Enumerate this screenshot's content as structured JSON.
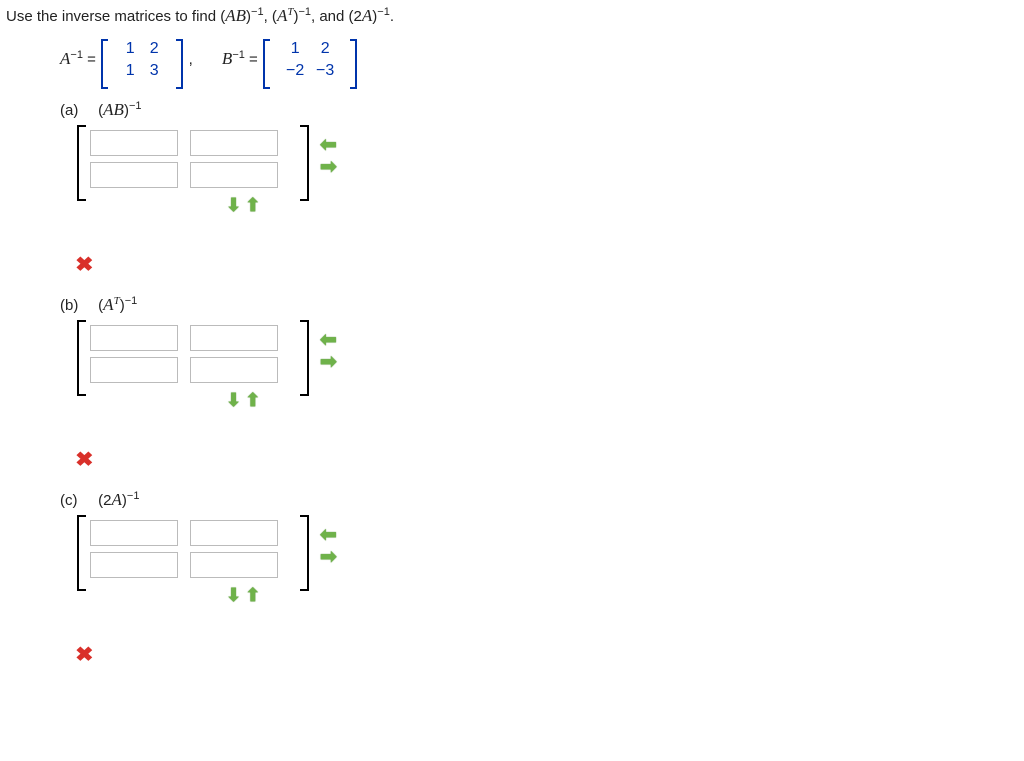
{
  "prompt_parts": {
    "p1": "Use the inverse matrices to find (",
    "p2": ")",
    "p3": ", (",
    "p4": ")",
    "p5": ", and (2",
    "p6": ")",
    "p7": "."
  },
  "sym": {
    "A": "A",
    "B": "B",
    "T": "T",
    "neg1": "−1",
    "AB": "AB",
    "twoA": "2A",
    "equals": " = ",
    "comma": ","
  },
  "Ainv": {
    "r1c1": "1",
    "r1c2": "2",
    "r2c1": "1",
    "r2c2": "3"
  },
  "Binv": {
    "r1c1": "1",
    "r1c2": "2",
    "r2c1": "−2",
    "r2c2": "−3"
  },
  "parts": {
    "a": {
      "lbl": "(a)",
      "expr_open": "(",
      "expr_mid": "AB",
      "expr_close": ")"
    },
    "b": {
      "lbl": "(b)",
      "expr_open": "(",
      "expr_mid": "A",
      "expr_sup": "T",
      "expr_close": ")"
    },
    "c": {
      "lbl": "(c)",
      "expr_open": "(2",
      "expr_mid": "A",
      "expr_close": ")"
    }
  },
  "arrows": {
    "left": "⬅",
    "right": "➡",
    "down": "⬇",
    "up": "⬆"
  },
  "wrong": "✖"
}
